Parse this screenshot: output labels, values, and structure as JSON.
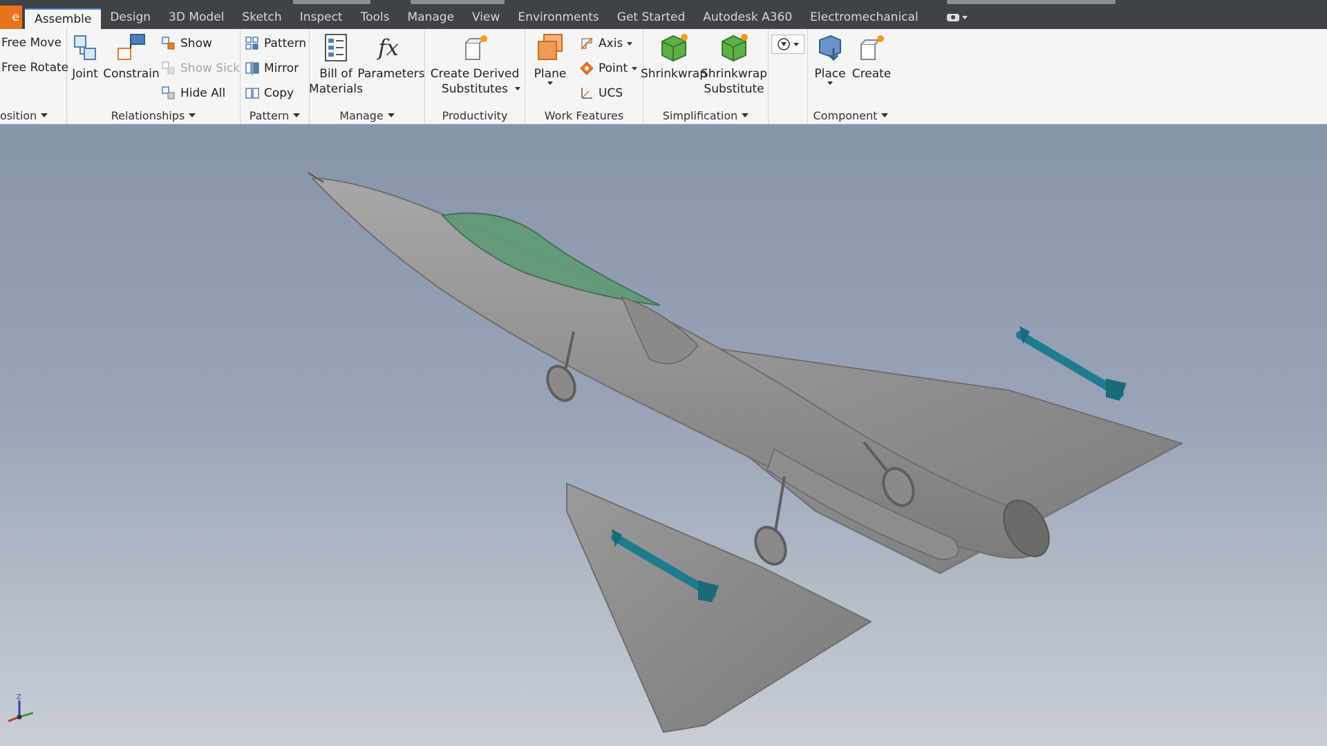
{
  "tabs": {
    "file_label": "e",
    "items": [
      "Assemble",
      "Design",
      "3D Model",
      "Sketch",
      "Inspect",
      "Tools",
      "Manage",
      "View",
      "Environments",
      "Get Started",
      "Autodesk A360",
      "Electromechanical"
    ],
    "active": "Assemble"
  },
  "ribbon": {
    "position": {
      "title": "osition",
      "free_move": "Free Move",
      "free_rotate": "Free Rotate"
    },
    "relationships": {
      "title": "Relationships",
      "joint": "Joint",
      "constrain": "Constrain",
      "show": "Show",
      "show_sick": "Show Sick",
      "hide_all": "Hide All"
    },
    "pattern": {
      "title": "Pattern",
      "pattern": "Pattern",
      "mirror": "Mirror",
      "copy": "Copy"
    },
    "manage": {
      "title": "Manage",
      "bom_line1": "Bill of",
      "bom_line2": "Materials",
      "parameters": "Parameters"
    },
    "productivity": {
      "title": "Productivity",
      "derived_line1": "Create Derived",
      "derived_line2": "Substitutes"
    },
    "work_features": {
      "title": "Work Features",
      "plane": "Plane",
      "axis": "Axis",
      "point": "Point",
      "ucs": "UCS"
    },
    "simplification": {
      "title": "Simplification",
      "shrinkwrap": "Shrinkwrap",
      "sub_line1": "Shrinkwrap",
      "sub_line2": "Substitute"
    },
    "component": {
      "title": "Component",
      "place": "Place",
      "create": "Create"
    }
  },
  "colors": {
    "tab_bar": "#3f4247",
    "file_tab": "#e8731c",
    "ribbon_bg": "#f5f5f5",
    "accent_blue": "#3b8bd8",
    "missile": "#1f7b8e",
    "aircraft": "#8f8f8f"
  },
  "viewport": {
    "model": "delta-wing-fighter-aircraft",
    "triad_label": "Z"
  }
}
